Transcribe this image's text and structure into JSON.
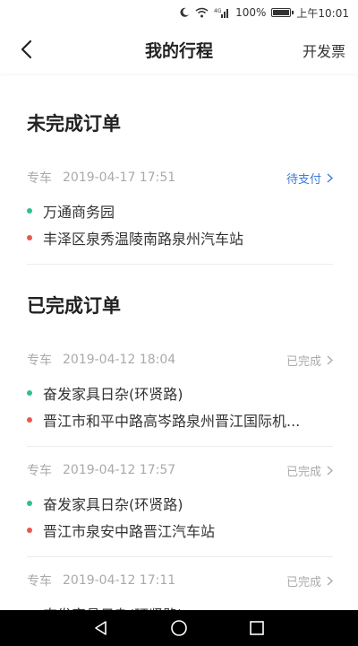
{
  "status_bar": {
    "battery": "100%",
    "time": "上午10:01",
    "network": "4G"
  },
  "nav": {
    "title": "我的行程",
    "invoice_label": "开发票"
  },
  "sections": {
    "unfinished_title": "未完成订单",
    "finished_title": "已完成订单"
  },
  "unfinished_orders": [
    {
      "type": "专车",
      "time": "2019-04-17 17:51",
      "status": "待支付",
      "start": "万通商务园",
      "end": "丰泽区泉秀温陵南路泉州汽车站"
    }
  ],
  "finished_orders": [
    {
      "type": "专车",
      "time": "2019-04-12 18:04",
      "status": "已完成",
      "start": "奋发家具日杂(环贤路)",
      "end": "晋江市和平中路高岑路泉州晋江国际机..."
    },
    {
      "type": "专车",
      "time": "2019-04-12 17:57",
      "status": "已完成",
      "start": "奋发家具日杂(环贤路)",
      "end": "晋江市泉安中路晋江汽车站"
    },
    {
      "type": "专车",
      "time": "2019-04-12 17:11",
      "status": "已完成",
      "start": "奋发家具日杂(环贤路)"
    }
  ],
  "colors": {
    "start_dot": "#2ec18b",
    "end_dot": "#e9584e",
    "pending": "#3d7bdc"
  }
}
